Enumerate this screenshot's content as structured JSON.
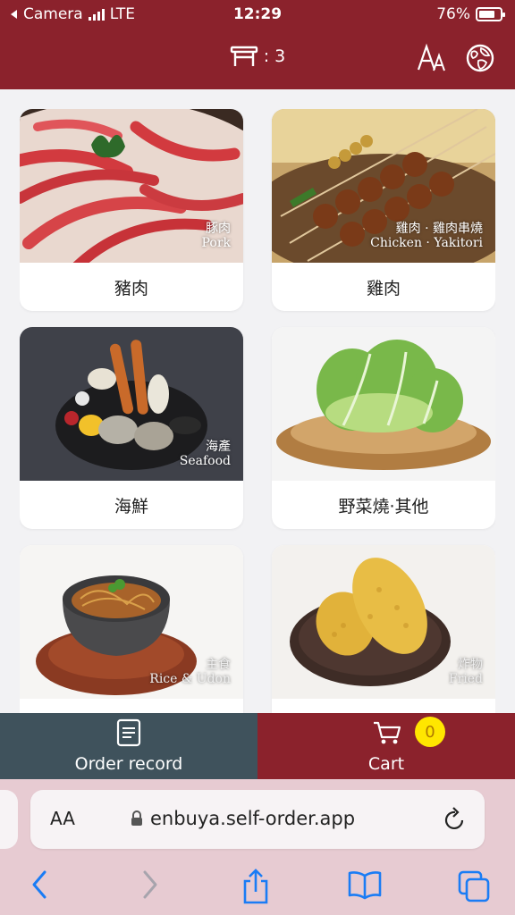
{
  "status_bar": {
    "back_app": "Camera",
    "network": "LTE",
    "time": "12:29",
    "battery": "76%",
    "battery_level": 0.76
  },
  "header": {
    "table_number": ": 3",
    "icons": [
      "table-icon",
      "font-size-icon",
      "language-globe-icon"
    ]
  },
  "menu": {
    "categories": [
      {
        "label": "豬肉",
        "caption_zh": "豚肉",
        "caption_en": "Pork"
      },
      {
        "label": "雞肉",
        "caption_zh": "雞肉 · 雞肉串燒",
        "caption_en": "Chicken · Yakitori"
      },
      {
        "label": "海鮮",
        "caption_zh": "海產",
        "caption_en": "Seafood"
      },
      {
        "label": "野菜燒·其他",
        "caption_zh": "",
        "caption_en": ""
      },
      {
        "label": "",
        "caption_zh": "主食",
        "caption_en": "Rice & Udon"
      },
      {
        "label": "",
        "caption_zh": "炸物",
        "caption_en": "Fried"
      }
    ]
  },
  "bottom_nav": {
    "order_record_label": "Order record",
    "cart_label": "Cart",
    "cart_count": "0"
  },
  "browser": {
    "aa_label": "AA",
    "url": "enbuya.self-order.app"
  },
  "colors": {
    "brand": "#8b222c",
    "order_nav": "#3f525c",
    "badge": "#ffe600",
    "ios_blue": "#1a7cf5"
  }
}
